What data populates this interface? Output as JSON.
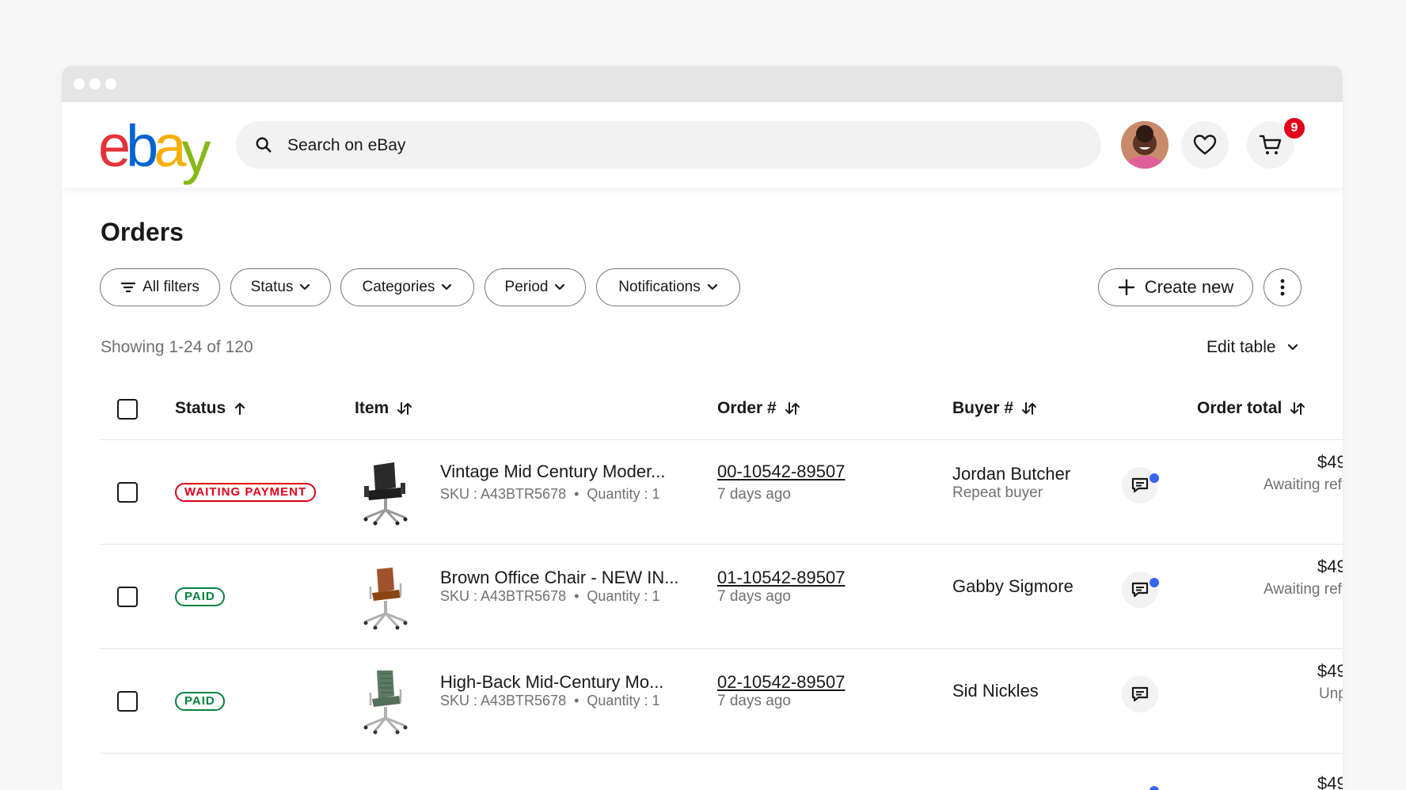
{
  "brand": {
    "logo_letters": [
      "e",
      "b",
      "a",
      "y"
    ],
    "logo_colors": [
      "#e53238",
      "#0064d2",
      "#f5af02",
      "#86b817"
    ]
  },
  "header": {
    "search_placeholder": "Search on eBay",
    "cart_count": "9",
    "icons": [
      "search-icon",
      "avatar",
      "heart-icon",
      "cart-icon"
    ]
  },
  "page": {
    "title": "Orders",
    "filters": {
      "all_filters": "All filters",
      "status": "Status",
      "categories": "Categories",
      "period": "Period",
      "notifications": "Notifications"
    },
    "create_new": "Create new",
    "showing": "Showing 1-24 of 120",
    "edit_table": "Edit table"
  },
  "table": {
    "columns": {
      "status": "Status",
      "item": "Item",
      "order": "Order #",
      "buyer": "Buyer #",
      "total": "Order total"
    },
    "rows": [
      {
        "status": "WAITING PAYMENT",
        "status_color": "#e0001b",
        "title": "Vintage Mid Century Moder...",
        "sku": "SKU : A43BTR5678",
        "quantity": "Quantity : 1",
        "order_number": "00-10542-89507",
        "order_time": "7 days ago",
        "buyer": "Jordan Butcher",
        "buyer_note": "Repeat buyer",
        "unread": true,
        "total": "$49",
        "total_note": "Awaiting ref"
      },
      {
        "status": "PAID",
        "status_color": "#05823f",
        "title": "Brown Office Chair - NEW IN...",
        "sku": "SKU : A43BTR5678",
        "quantity": "Quantity : 1",
        "order_number": "01-10542-89507",
        "order_time": "7 days ago",
        "buyer": "Gabby Sigmore",
        "buyer_note": "",
        "unread": true,
        "total": "$49",
        "total_note": "Awaiting ref"
      },
      {
        "status": "PAID",
        "status_color": "#05823f",
        "title": "High-Back Mid-Century Mo...",
        "sku": "SKU : A43BTR5678",
        "quantity": "Quantity : 1",
        "order_number": "02-10542-89507",
        "order_time": "7 days ago",
        "buyer": "Sid Nickles",
        "buyer_note": "",
        "unread": false,
        "total": "$49",
        "total_note": "Unp"
      },
      {
        "total": "$49"
      }
    ]
  }
}
